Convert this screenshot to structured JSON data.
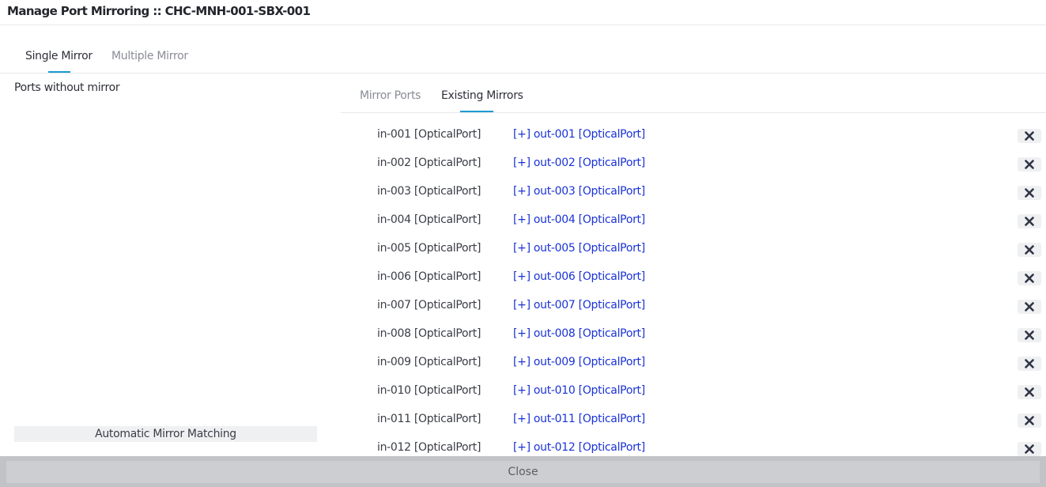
{
  "window": {
    "title": "Manage Port Mirroring :: CHC-MNH-001-SBX-001"
  },
  "main_tabs": [
    {
      "label": "Single Mirror",
      "active": true
    },
    {
      "label": "Multiple Mirror",
      "active": false
    }
  ],
  "left_panel": {
    "title": "Ports without mirror",
    "auto_button": "Automatic Mirror Matching"
  },
  "sub_tabs": [
    {
      "label": "Mirror Ports",
      "active": false
    },
    {
      "label": "Existing Mirrors",
      "active": true
    }
  ],
  "mirrors": [
    {
      "in": "in-001 [OpticalPort]",
      "out": "[+] out-001 [OpticalPort]"
    },
    {
      "in": "in-002 [OpticalPort]",
      "out": "[+] out-002 [OpticalPort]"
    },
    {
      "in": "in-003 [OpticalPort]",
      "out": "[+] out-003 [OpticalPort]"
    },
    {
      "in": "in-004 [OpticalPort]",
      "out": "[+] out-004 [OpticalPort]"
    },
    {
      "in": "in-005 [OpticalPort]",
      "out": "[+] out-005 [OpticalPort]"
    },
    {
      "in": "in-006 [OpticalPort]",
      "out": "[+] out-006 [OpticalPort]"
    },
    {
      "in": "in-007 [OpticalPort]",
      "out": "[+] out-007 [OpticalPort]"
    },
    {
      "in": "in-008 [OpticalPort]",
      "out": "[+] out-008 [OpticalPort]"
    },
    {
      "in": "in-009 [OpticalPort]",
      "out": "[+] out-009 [OpticalPort]"
    },
    {
      "in": "in-010 [OpticalPort]",
      "out": "[+] out-010 [OpticalPort]"
    },
    {
      "in": "in-011 [OpticalPort]",
      "out": "[+] out-011 [OpticalPort]"
    },
    {
      "in": "in-012 [OpticalPort]",
      "out": "[+] out-012 [OpticalPort]"
    }
  ],
  "remove_icon": "close-icon",
  "footer": {
    "close_label": "Close"
  },
  "colors": {
    "accent": "#1b9bd1",
    "link": "#1a33d6",
    "footer_bg": "#c2c3c7"
  }
}
